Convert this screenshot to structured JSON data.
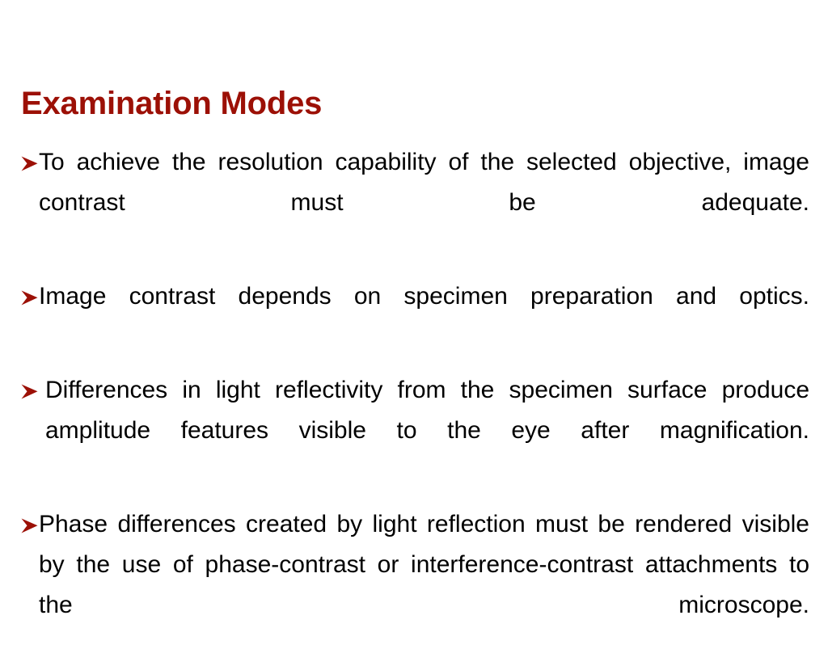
{
  "slide": {
    "title": "Examination Modes",
    "title_color": "#9C1006",
    "background_color": "#FFFFFF",
    "text_color": "#000000",
    "bullet_marker": "arrowhead-bullet",
    "bullet_color": "#9C1006",
    "bullets": [
      {
        "text": "To achieve the resolution capability of the selected objective, image contrast must be adequate.",
        "leading_space": false
      },
      {
        "text": "Image contrast depends on specimen preparation and optics.",
        "leading_space": false
      },
      {
        "text": "Differences in light reflectivity from the specimen surface produce amplitude features visible to the eye after magnification.",
        "leading_space": true
      },
      {
        "text": "Phase differences created by light reflection must be rendered visible by the use of phase-contrast or interference-contrast attachments to the microscope.",
        "leading_space": false
      }
    ]
  }
}
